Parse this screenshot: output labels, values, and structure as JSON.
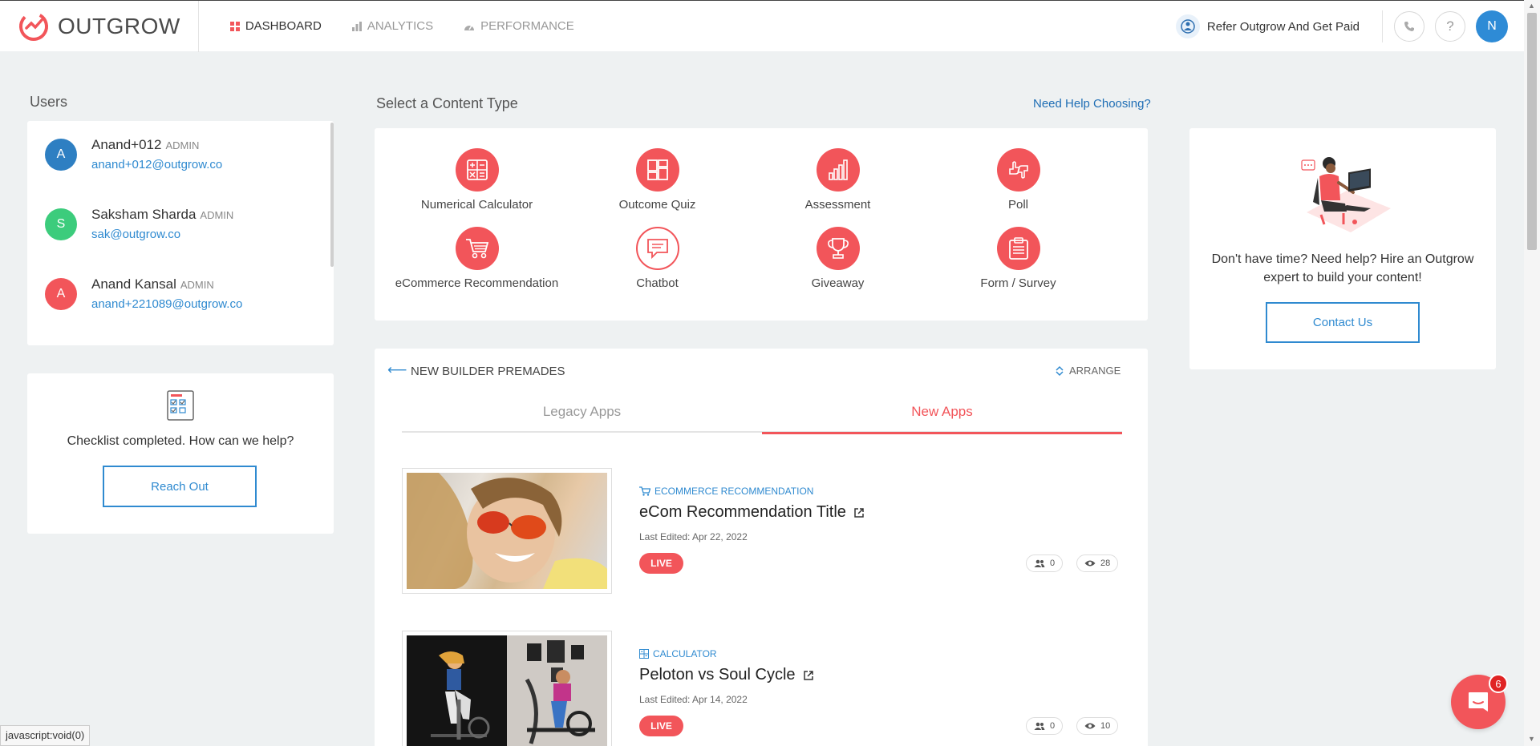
{
  "brand": {
    "name": "OUTGROW",
    "accent": "#f2555a",
    "link": "#2f8ad0"
  },
  "nav": {
    "items": [
      {
        "label": "DASHBOARD",
        "icon": "dashboard-grid-icon",
        "active": true
      },
      {
        "label": "ANALYTICS",
        "icon": "bar-chart-icon",
        "active": false
      },
      {
        "label": "PERFORMANCE",
        "icon": "speedometer-icon",
        "active": false
      }
    ],
    "refer_label": "Refer Outgrow And Get Paid",
    "phone_icon": "phone-icon",
    "help_label": "?",
    "avatar_initial": "N"
  },
  "users": {
    "title": "Users",
    "list": [
      {
        "initial": "A",
        "name": "Anand+012",
        "role": "ADMIN",
        "email": "anand+012@outgrow.co",
        "color": "#2e7fc2"
      },
      {
        "initial": "S",
        "name": "Saksham Sharda",
        "role": "ADMIN",
        "email": "sak@outgrow.co",
        "color": "#3ccc7c"
      },
      {
        "initial": "A",
        "name": "Anand Kansal",
        "role": "ADMIN",
        "email": "anand+221089@outgrow.co",
        "color": "#f2555a"
      }
    ]
  },
  "checklist": {
    "text": "Checklist completed. How can we help?",
    "button": "Reach Out"
  },
  "content_types": {
    "title": "Select a Content Type",
    "help_link": "Need Help Choosing?",
    "items": [
      {
        "label": "Numerical Calculator",
        "icon": "calculator-icon"
      },
      {
        "label": "Outcome Quiz",
        "icon": "quiz-grid-icon"
      },
      {
        "label": "Assessment",
        "icon": "assessment-bars-icon"
      },
      {
        "label": "Poll",
        "icon": "thumbs-poll-icon"
      },
      {
        "label": "eCommerce Recommendation",
        "icon": "cart-icon"
      },
      {
        "label": "Chatbot",
        "icon": "chat-bubble-icon"
      },
      {
        "label": "Giveaway",
        "icon": "trophy-icon"
      },
      {
        "label": "Form / Survey",
        "icon": "clipboard-icon"
      }
    ]
  },
  "premades": {
    "title": "NEW BUILDER PREMADES",
    "arrange_label": "ARRANGE",
    "tabs": [
      {
        "label": "Legacy Apps",
        "active": false
      },
      {
        "label": "New Apps",
        "active": true
      }
    ],
    "apps": [
      {
        "category": "ECOMMERCE RECOMMENDATION",
        "category_icon": "cart-icon",
        "title": "eCom Recommendation Title",
        "edited": "Last Edited: Apr 22, 2022",
        "status": "LIVE",
        "users": "0",
        "views": "28"
      },
      {
        "category": "CALCULATOR",
        "category_icon": "calculator-icon",
        "title": "Peloton vs Soul Cycle",
        "edited": "Last Edited: Apr 14, 2022",
        "status": "LIVE",
        "users": "0",
        "views": "10"
      }
    ]
  },
  "hire": {
    "text": "Don't have time? Need help? Hire an Outgrow expert to build your content!",
    "button": "Contact Us"
  },
  "status_bar": "javascript:void(0)",
  "chat": {
    "badge": "6"
  }
}
